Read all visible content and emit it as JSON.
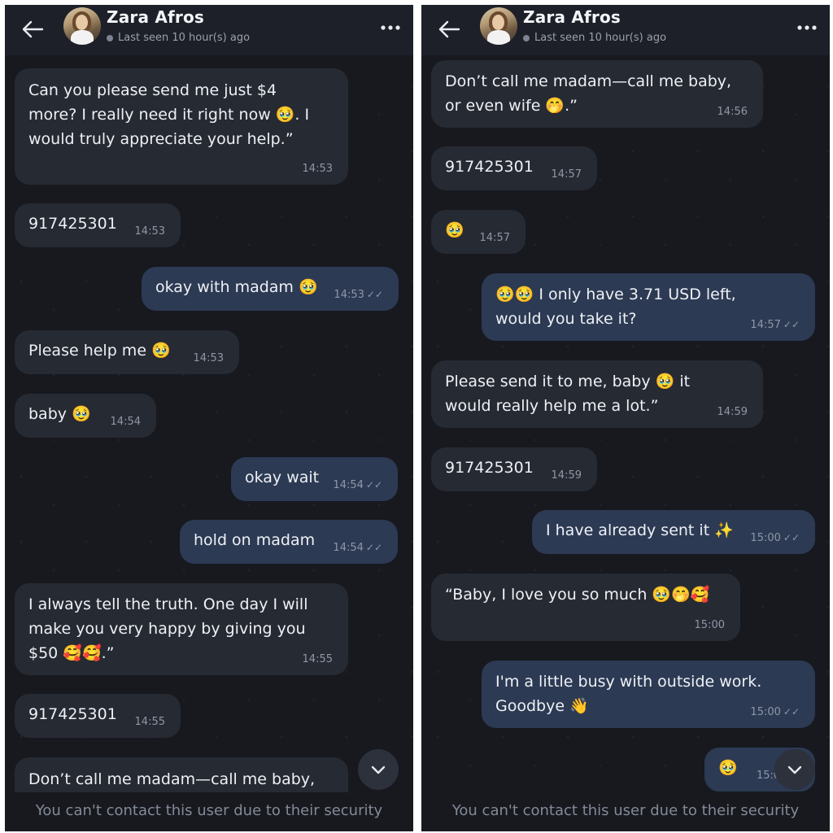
{
  "contact": {
    "name": "Zara Afros",
    "status": "Last seen 10 hour(s) ago"
  },
  "footer": {
    "notice": "You can't contact this user due to their security"
  },
  "icons": {
    "back": "back-arrow-icon",
    "more": "more-options-icon",
    "scroll": "chevron-down-icon",
    "read": "double-check-icon"
  },
  "colors": {
    "background": "#17191f",
    "incoming_bubble": "#262a33",
    "outgoing_bubble": "#2c3a54",
    "header": "#1d2028"
  },
  "left": {
    "messages": [
      {
        "dir": "in",
        "text": "Can you please send me just $4\nmore? I really need it right now 🥹. I\nwould truly appreciate your help.”",
        "time": "14:53"
      },
      {
        "dir": "in",
        "text": "917425301",
        "time": "14:53"
      },
      {
        "dir": "out",
        "text": "okay with madam 🥹",
        "time": "14:53"
      },
      {
        "dir": "in",
        "text": "Please help me 🥹",
        "time": "14:53"
      },
      {
        "dir": "in",
        "text": "baby 🥹",
        "time": "14:54"
      },
      {
        "dir": "out",
        "text": "okay wait",
        "time": "14:54"
      },
      {
        "dir": "out",
        "text": "hold on madam",
        "time": "14:54"
      },
      {
        "dir": "in",
        "text": "I always tell the truth. One day I will\nmake you very happy by giving you\n$50 🥰🥰.”",
        "time": "14:55"
      },
      {
        "dir": "in",
        "text": "917425301",
        "time": "14:55"
      },
      {
        "dir": "in",
        "text": "Don’t call me madam—call me baby,",
        "time": ""
      }
    ]
  },
  "right": {
    "messages": [
      {
        "dir": "in",
        "text": "Don’t call me madam—call me baby,\nor even wife 🤭.”",
        "time": "14:56"
      },
      {
        "dir": "in",
        "text": "917425301",
        "time": "14:57"
      },
      {
        "dir": "in",
        "text": "🥹",
        "time": "14:57"
      },
      {
        "dir": "out",
        "text": "🥹🥹 I only have 3.71 USD left,\nwould you take it?",
        "time": "14:57"
      },
      {
        "dir": "in",
        "text": "Please send it to me, baby 🥹 it\nwould really help me a lot.”",
        "time": "14:59"
      },
      {
        "dir": "in",
        "text": "917425301",
        "time": "14:59"
      },
      {
        "dir": "out",
        "text": "I have already sent it ✨",
        "time": "15:00"
      },
      {
        "dir": "in",
        "text": "“Baby, I love you so much 🥹🤭🥰",
        "time": "15:00"
      },
      {
        "dir": "out",
        "text": "I'm a little busy with outside work.\nGoodbye 👋",
        "time": "15:00"
      },
      {
        "dir": "out",
        "text": "🥹",
        "time": "15:0"
      }
    ]
  }
}
